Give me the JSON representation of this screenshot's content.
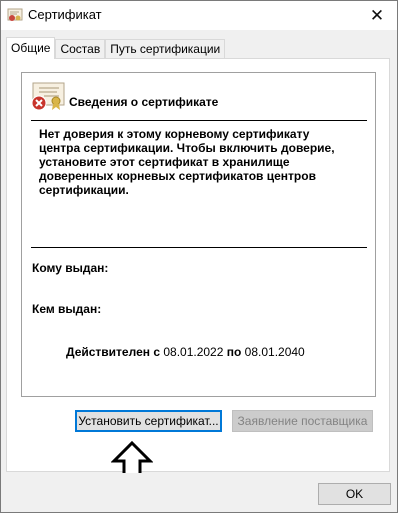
{
  "window": {
    "title": "Сертификат",
    "close_icon": "close-icon"
  },
  "tabs": [
    {
      "label": "Общие",
      "active": true
    },
    {
      "label": "Состав",
      "active": false
    },
    {
      "label": "Путь сертификации",
      "active": false
    }
  ],
  "info": {
    "heading": "Сведения о сертификате",
    "warning_lines": [
      "Нет доверия к этому корневому сертификату",
      "центра сертификации. Чтобы включить  доверие,",
      "установите этот сертификат в хранилище",
      "доверенных корневых сертификатов центров",
      "сертификации."
    ],
    "issued_to_label": "Кому выдан:",
    "issued_by_label": "Кем выдан:",
    "valid_from_label": "Действителен с",
    "valid_from": "08.01.2022",
    "valid_to_label": "по",
    "valid_to": "08.01.2040"
  },
  "buttons": {
    "install": "Установить сертификат...",
    "issuer_statement": "Заявление поставщика",
    "ok": "OK"
  },
  "colors": {
    "accent": "#0078d7",
    "panel": "#ffffff",
    "window": "#f0f0f0"
  }
}
